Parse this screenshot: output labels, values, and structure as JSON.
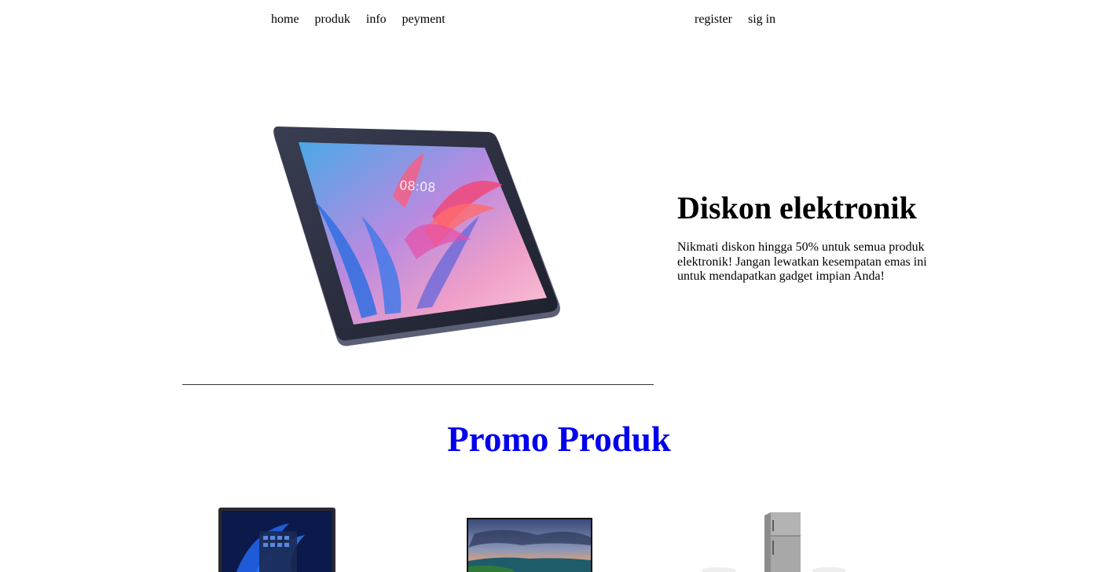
{
  "nav": {
    "left": [
      {
        "label": "home"
      },
      {
        "label": "produk"
      },
      {
        "label": "info"
      },
      {
        "label": "peyment"
      }
    ],
    "right": [
      {
        "label": "register"
      },
      {
        "label": "sig in"
      }
    ]
  },
  "hero": {
    "title": "Diskon elektronik",
    "description": "Nikmati diskon hingga 50% untuk semua produk elektronik! Jangan lewatkan kesempatan emas ini untuk mendapatkan gadget impian Anda!",
    "image_icon": "tablet-image",
    "screen_clock": "08:08"
  },
  "promo": {
    "title": "Promo Produk",
    "title_color": "#0000ee",
    "products": [
      {
        "icon": "laptop-image"
      },
      {
        "icon": "tv-image"
      },
      {
        "icon": "refrigerator-image"
      }
    ]
  }
}
